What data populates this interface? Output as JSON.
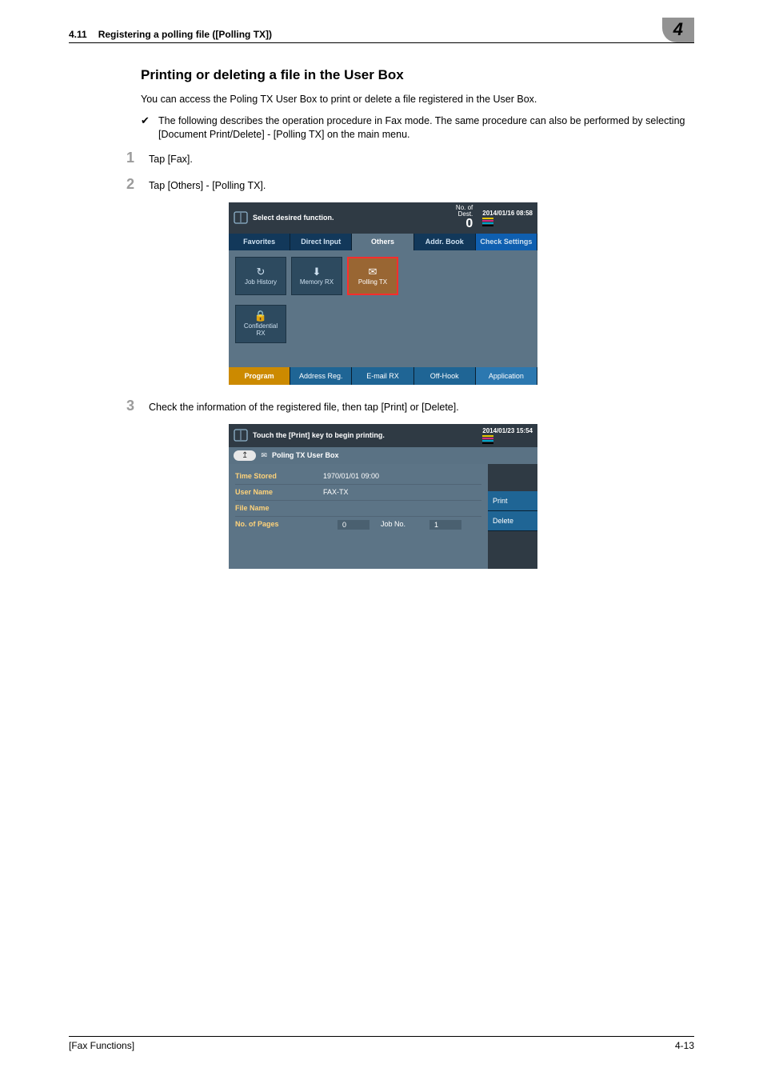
{
  "header": {
    "section_number": "4.11",
    "section_title": "Registering a polling file ([Polling TX])",
    "chapter_badge": "4"
  },
  "heading": "Printing or deleting a file in the User Box",
  "intro": "You can access the Poling TX User Box to print or delete a file registered in the User Box.",
  "note": "The following describes the operation procedure in Fax mode. The same procedure can also be performed by selecting [Document Print/Delete] - [Polling TX] on the main menu.",
  "steps": {
    "s1": "Tap [Fax].",
    "s2": "Tap [Others] - [Polling TX].",
    "s3": "Check the information of the registered file, then tap [Print] or [Delete]."
  },
  "panel1": {
    "message": "Select desired function.",
    "dest_label": "No. of\nDest.",
    "dest_count": "0",
    "timestamp": "2014/01/16 08:58",
    "tabs": {
      "favorites": "Favorites",
      "direct": "Direct Input",
      "others": "Others",
      "addr": "Addr. Book",
      "check": "Check Settings"
    },
    "cells": {
      "job": "Job History",
      "mem": "Memory RX",
      "poll": "Polling TX",
      "conf": "Confidential\nRX"
    },
    "bottom": {
      "program": "Program",
      "addr_reg": "Address Reg.",
      "email": "E-mail RX",
      "offhook": "Off-Hook",
      "app": "Application"
    }
  },
  "panel2": {
    "message": "Touch the [Print] key to begin printing.",
    "timestamp": "2014/01/23 15:54",
    "breadcrumb": "Poling TX User Box",
    "rows": {
      "time_stored_k": "Time Stored",
      "time_stored_v": "1970/01/01 09:00",
      "user_k": "User Name",
      "user_v": "FAX-TX",
      "file_k": "File Name",
      "file_v": "",
      "pages_k": "No. of Pages",
      "pages_v": "0",
      "jobno_k": "Job No.",
      "jobno_v": "1"
    },
    "buttons": {
      "print": "Print",
      "delete": "Delete"
    }
  },
  "footer": {
    "left": "[Fax Functions]",
    "right": "4-13"
  }
}
